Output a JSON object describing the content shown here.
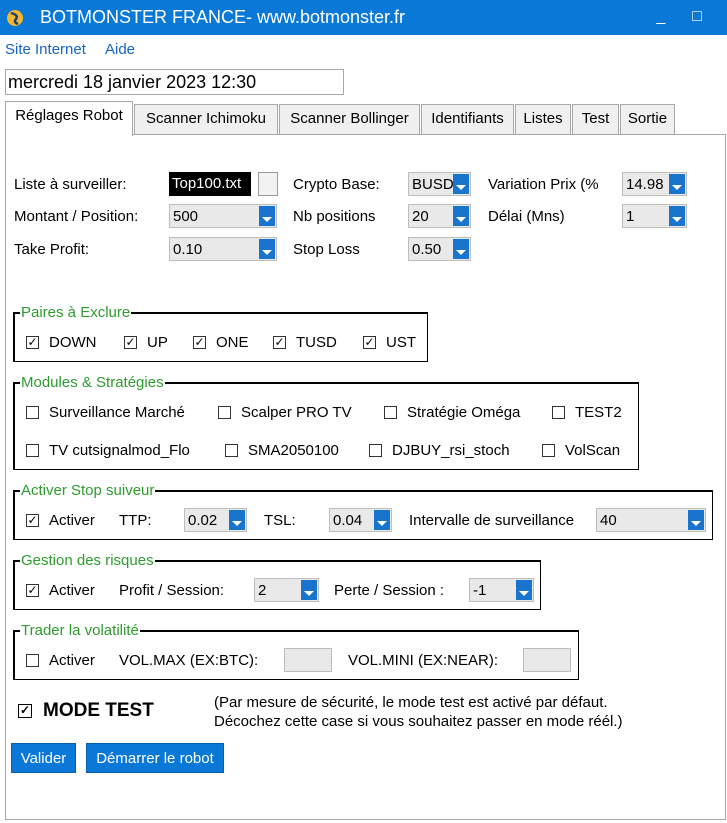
{
  "window": {
    "title": "BOTMONSTER FRANCE- www.botmonster.fr",
    "minimize": "_",
    "maximize": "□"
  },
  "menu": {
    "site": "Site Internet",
    "help": "Aide"
  },
  "datetime": "mercredi 18 janvier 2023 12:30",
  "tabs": [
    "Réglages Robot",
    "Scanner Ichimoku",
    "Scanner Bollinger",
    "Identifiants",
    "Listes",
    "Test",
    "Sortie"
  ],
  "settings": {
    "watchlist_label": "Liste à surveiller:",
    "watchlist_value": "Top100.txt",
    "crypto_base_label": "Crypto Base:",
    "crypto_base_value": "BUSD",
    "price_var_label": "Variation Prix (%",
    "price_var_value": "14.98",
    "amount_label": "Montant / Position:",
    "amount_value": "500",
    "nb_positions_label": "Nb positions",
    "nb_positions_value": "20",
    "delay_label": "Délai (Mns)",
    "delay_value": "1",
    "take_profit_label": "Take Profit:",
    "take_profit_value": "0.10",
    "stop_loss_label": "Stop Loss",
    "stop_loss_value": "0.50"
  },
  "exclude": {
    "title": "Paires à Exclure",
    "items": [
      {
        "label": "DOWN",
        "checked": true
      },
      {
        "label": "UP",
        "checked": true
      },
      {
        "label": "ONE",
        "checked": true
      },
      {
        "label": "TUSD",
        "checked": true
      },
      {
        "label": "UST",
        "checked": true
      }
    ]
  },
  "modules": {
    "title": "Modules & Stratégies",
    "items": [
      {
        "label": "Surveillance Marché",
        "checked": false
      },
      {
        "label": "Scalper PRO TV",
        "checked": false
      },
      {
        "label": "Stratégie Oméga",
        "checked": false
      },
      {
        "label": "TEST2",
        "checked": false
      },
      {
        "label": "TV cutsignalmod_Flo",
        "checked": false
      },
      {
        "label": "SMA2050100",
        "checked": false
      },
      {
        "label": "DJBUY_rsi_stoch",
        "checked": false
      },
      {
        "label": "VolScan",
        "checked": false
      }
    ]
  },
  "trailing": {
    "title": "Activer Stop suiveur",
    "activate_label": "Activer",
    "ttp_label": "TTP:",
    "ttp_value": "0.02",
    "tsl_label": "TSL:",
    "tsl_value": "0.04",
    "interval_label": "Intervalle de surveillance",
    "interval_value": "40"
  },
  "risk": {
    "title": "Gestion des risques",
    "activate_label": "Activer",
    "profit_label": "Profit / Session:",
    "profit_value": "2",
    "loss_label": "Perte / Session :",
    "loss_value": "-1"
  },
  "volatility": {
    "title": "Trader la volatilité",
    "activate_label": "Activer",
    "volmax_label": "VOL.MAX (EX:BTC):",
    "volmini_label": "VOL.MINI (EX:NEAR):"
  },
  "mode_test": {
    "label": "MODE TEST",
    "checkmark": "✓",
    "note_line1": "(Par mesure de sécurité, le mode test est activé par défaut.",
    "note_line2": "Décochez cette case si vous souhaitez passer en mode réél.)"
  },
  "buttons": {
    "validate": "Valider",
    "start": "Démarrer le robot"
  },
  "colors": {
    "titlebar": "#0a78d7",
    "accent": "#1874cd",
    "group_title": "#2e9b2e",
    "link": "#1565c0"
  }
}
